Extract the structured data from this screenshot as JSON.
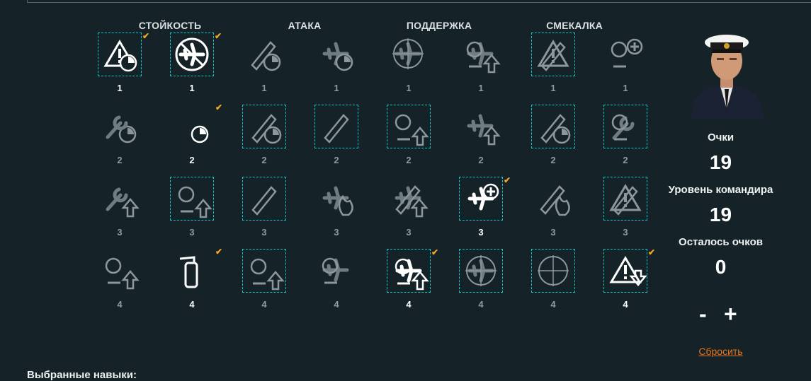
{
  "categories": [
    "СТОЙКОСТЬ",
    "АТАКА",
    "ПОДДЕРЖКА",
    "СМЕКАЛКА"
  ],
  "skills": [
    {
      "cost": "1",
      "icon": "warning-radius-icon",
      "selected": true,
      "checked": true,
      "lit": true
    },
    {
      "cost": "1",
      "icon": "no-aircraft-icon",
      "selected": true,
      "checked": true,
      "lit": true
    },
    {
      "cost": "1",
      "icon": "bomb-timer-icon",
      "selected": false,
      "checked": false,
      "lit": false
    },
    {
      "cost": "1",
      "icon": "aircraft-timer-icon",
      "selected": false,
      "checked": false,
      "lit": false
    },
    {
      "cost": "1",
      "icon": "aircraft-target-icon",
      "selected": false,
      "checked": false,
      "lit": false
    },
    {
      "cost": "1",
      "icon": "aircraft-list-upgrade-icon",
      "selected": false,
      "checked": false,
      "lit": false
    },
    {
      "cost": "1",
      "icon": "torpedo-warning-icon",
      "selected": true,
      "checked": false,
      "lit": false
    },
    {
      "cost": "1",
      "icon": "ammo-repair-icon",
      "selected": false,
      "checked": false,
      "lit": false
    },
    {
      "cost": "2",
      "icon": "wrench-timer-icon",
      "selected": false,
      "checked": false,
      "lit": false
    },
    {
      "cost": "2",
      "icon": "stopwatch-icon",
      "selected": false,
      "checked": true,
      "lit": true
    },
    {
      "cost": "2",
      "icon": "rocket-timer-icon",
      "selected": true,
      "checked": false,
      "lit": false
    },
    {
      "cost": "2",
      "icon": "rocket-arrow-icon",
      "selected": true,
      "checked": false,
      "lit": false
    },
    {
      "cost": "2",
      "icon": "smoke-upgrade-icon",
      "selected": true,
      "checked": false,
      "lit": false
    },
    {
      "cost": "2",
      "icon": "aircraft-upgrade-icon",
      "selected": false,
      "checked": false,
      "lit": false
    },
    {
      "cost": "2",
      "icon": "torpedo-timer-icon",
      "selected": true,
      "checked": false,
      "lit": false
    },
    {
      "cost": "2",
      "icon": "fan-wrench-icon",
      "selected": true,
      "checked": false,
      "lit": false
    },
    {
      "cost": "3",
      "icon": "wrench-upgrade-icon",
      "selected": false,
      "checked": false,
      "lit": false
    },
    {
      "cost": "3",
      "icon": "battleship-upgrade-icon",
      "selected": true,
      "checked": false,
      "lit": false
    },
    {
      "cost": "3",
      "icon": "bomb-reload-icon",
      "selected": true,
      "checked": false,
      "lit": false
    },
    {
      "cost": "3",
      "icon": "aircraft-fire-icon",
      "selected": false,
      "checked": false,
      "lit": false
    },
    {
      "cost": "3",
      "icon": "aircraft-bomb-upgrade-icon",
      "selected": false,
      "checked": false,
      "lit": false
    },
    {
      "cost": "3",
      "icon": "aircraft-repair-plus-icon",
      "selected": true,
      "checked": true,
      "lit": true
    },
    {
      "cost": "3",
      "icon": "torpedo-fire-icon",
      "selected": false,
      "checked": false,
      "lit": false
    },
    {
      "cost": "3",
      "icon": "rocket-warning-icon",
      "selected": true,
      "checked": false,
      "lit": false
    },
    {
      "cost": "4",
      "icon": "shield-upgrade-icon",
      "selected": false,
      "checked": false,
      "lit": false
    },
    {
      "cost": "4",
      "icon": "extinguisher-icon",
      "selected": false,
      "checked": true,
      "lit": true
    },
    {
      "cost": "4",
      "icon": "cross-upgrade-icon",
      "selected": true,
      "checked": false,
      "lit": false
    },
    {
      "cost": "4",
      "icon": "aircraft-swarm-icon",
      "selected": false,
      "checked": false,
      "lit": false
    },
    {
      "cost": "4",
      "icon": "aircraft-chevron-upgrade-icon",
      "selected": true,
      "checked": true,
      "lit": true
    },
    {
      "cost": "4",
      "icon": "radar-aircraft-icon",
      "selected": true,
      "checked": false,
      "lit": false
    },
    {
      "cost": "4",
      "icon": "radar-compass-icon",
      "selected": true,
      "checked": false,
      "lit": false
    },
    {
      "cost": "4",
      "icon": "warning-down-icon",
      "selected": true,
      "checked": true,
      "lit": true
    }
  ],
  "side": {
    "points_label": "Очки",
    "points_value": "19",
    "level_label": "Уровень командира",
    "level_value": "19",
    "remaining_label": "Осталось очков",
    "remaining_value": "0",
    "minus": "-",
    "plus": "+",
    "reset": "Сбросить"
  },
  "chosen_label": "Выбранные навыки:",
  "colors": {
    "accent": "#14c8cc",
    "check": "#f5a623",
    "reset": "#e8761c",
    "bg": "#152328"
  }
}
